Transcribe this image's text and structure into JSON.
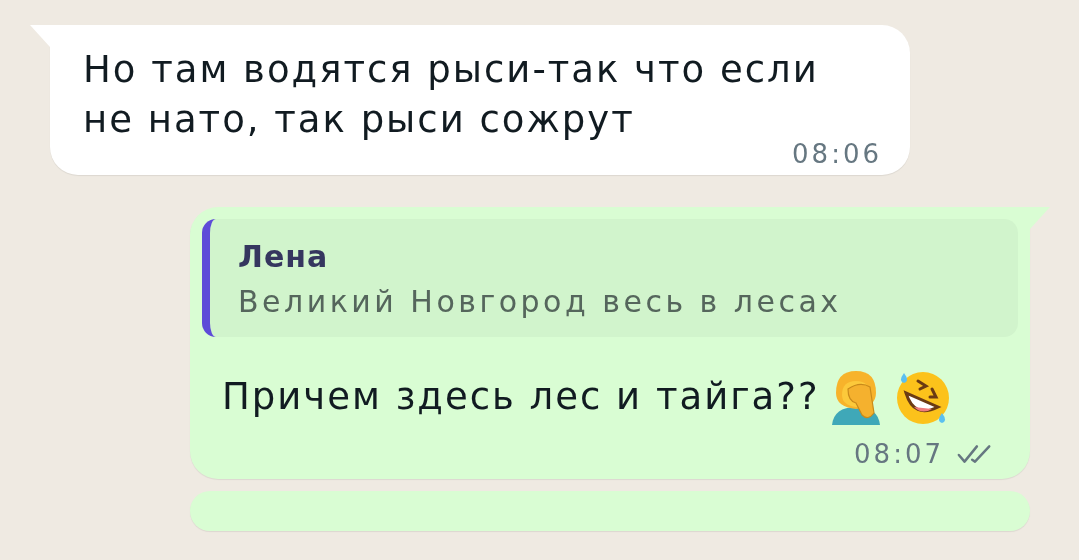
{
  "messages": [
    {
      "kind": "incoming",
      "text_lines": [
        "Но там водятся рыси-так что если",
        "не нато, так рыси сожрут"
      ],
      "time": "08:06"
    },
    {
      "kind": "outgoing",
      "reply": {
        "author": "Лена",
        "text": "Великий Новгород весь в лесах"
      },
      "text": "Причем здесь лес и тайга??",
      "emoji": [
        {
          "kind": "facepalm"
        },
        {
          "kind": "laughing"
        }
      ],
      "time": "08:07",
      "read": false
    }
  ]
}
